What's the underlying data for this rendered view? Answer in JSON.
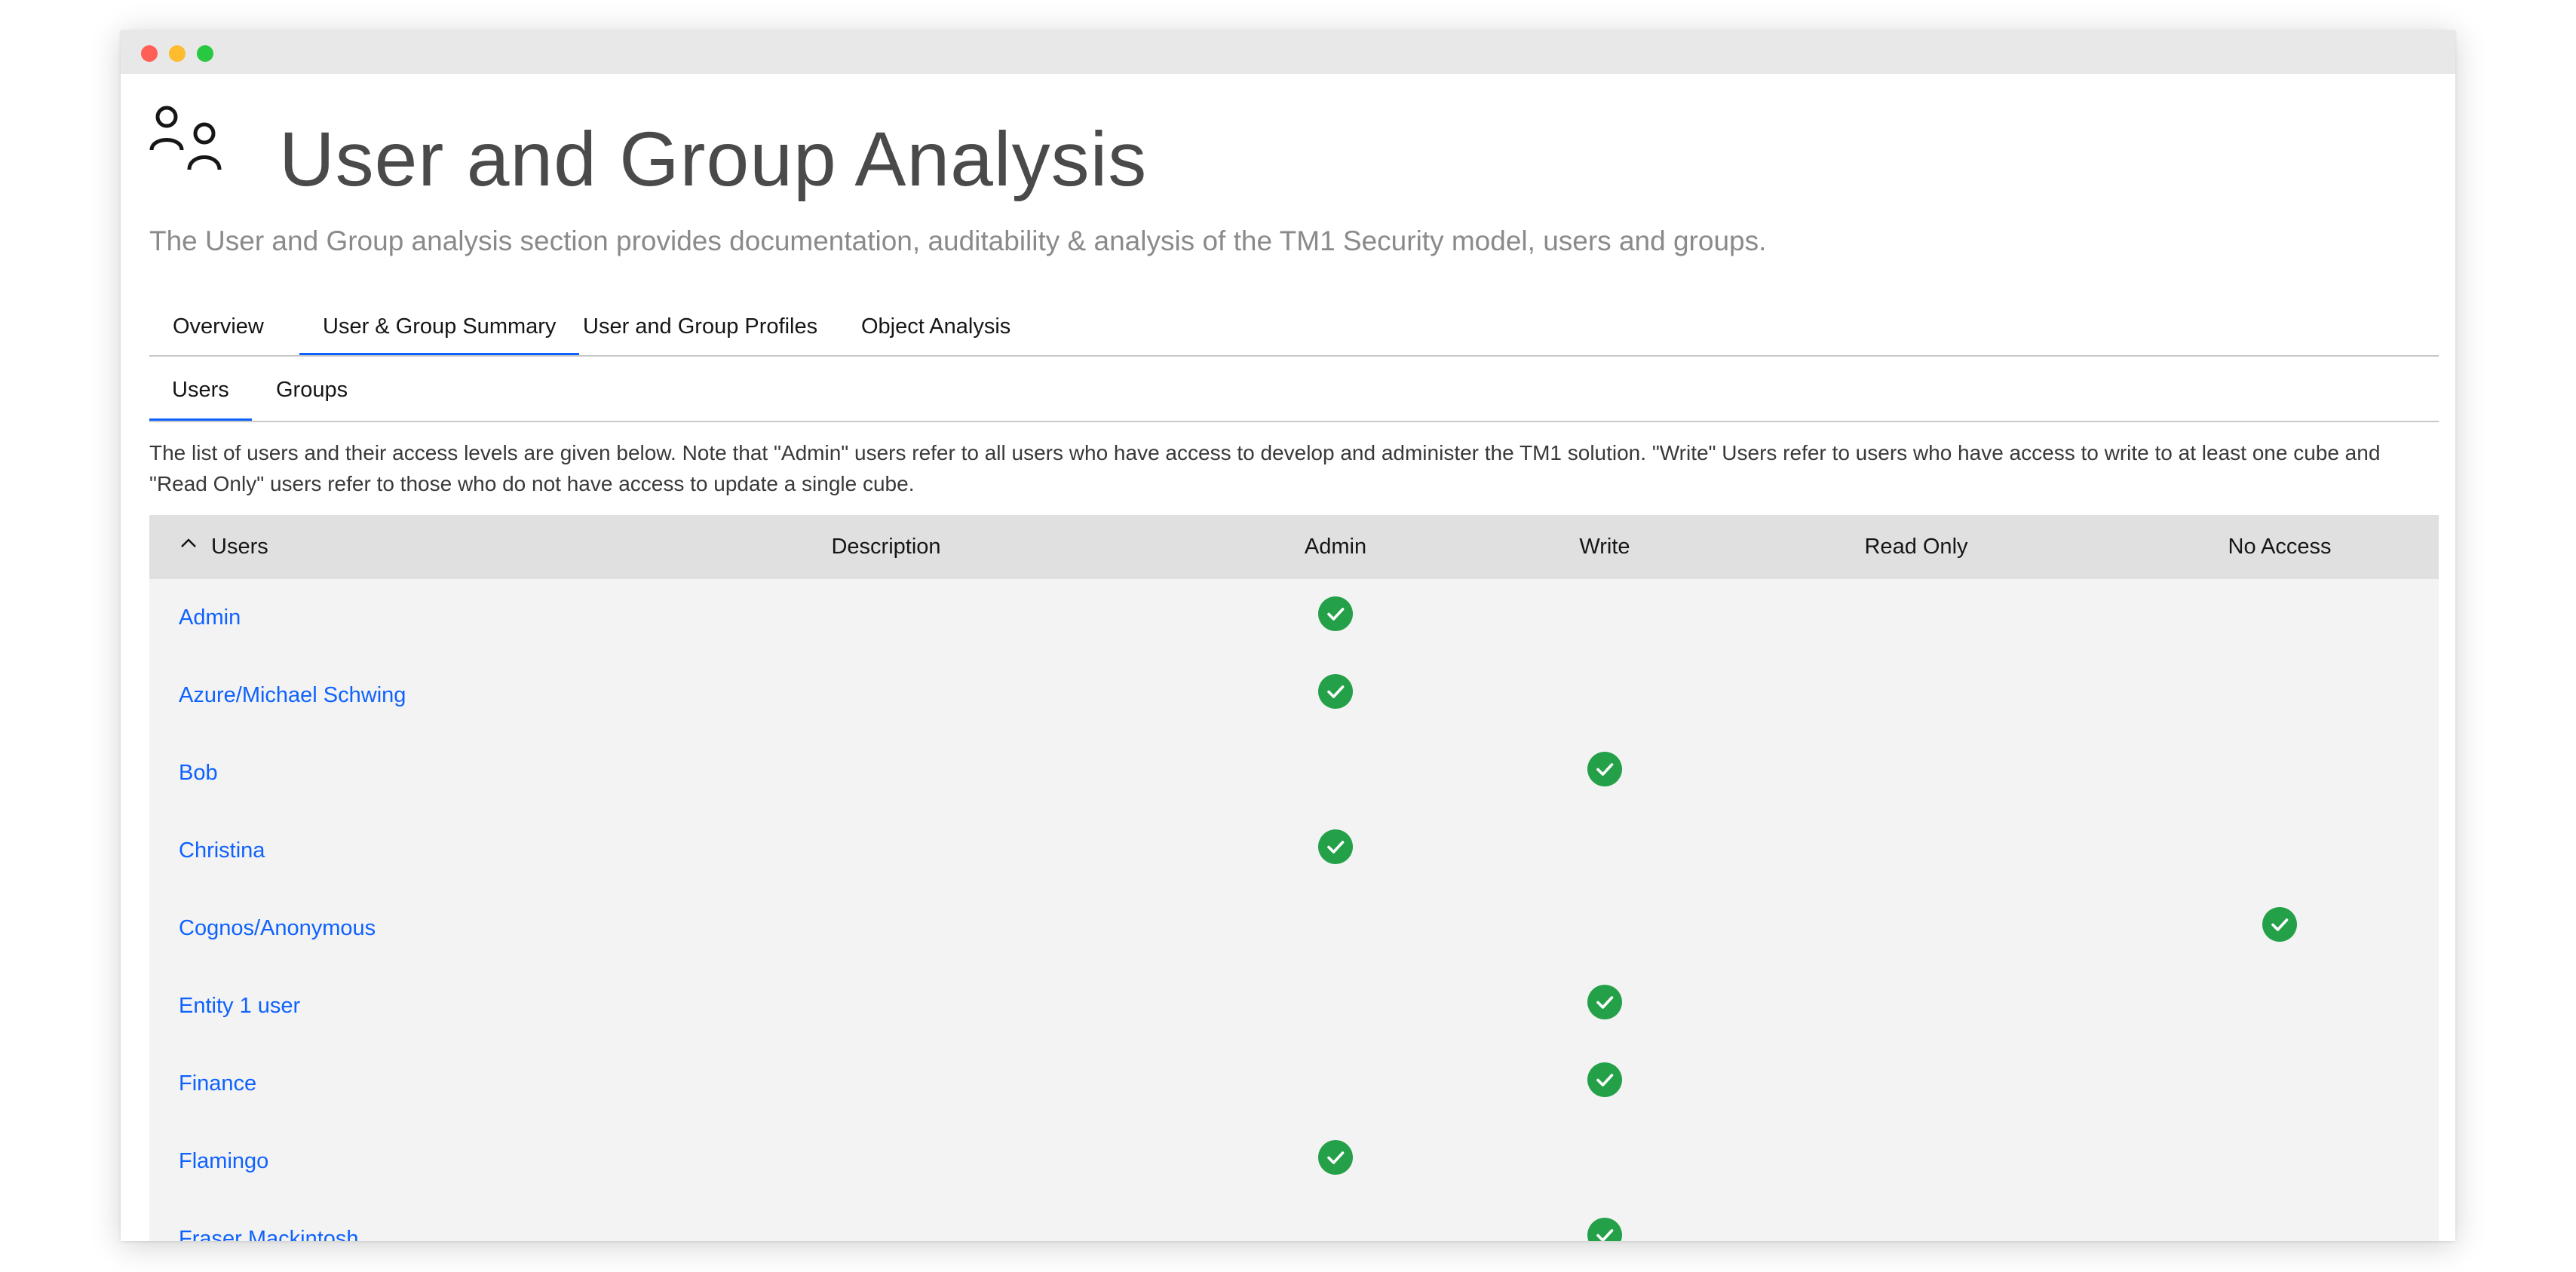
{
  "page": {
    "title": "User and Group Analysis",
    "subtitle": "The User and Group analysis section provides documentation, auditability & analysis of the TM1 Security model, users and groups.",
    "icon": "users-icon"
  },
  "tabs": [
    {
      "label": "Overview",
      "active": false
    },
    {
      "label": "User & Group Summary",
      "active": true
    },
    {
      "label": "User and Group Profiles",
      "active": false
    },
    {
      "label": "Object Analysis",
      "active": false
    }
  ],
  "subtabs": [
    {
      "label": "Users",
      "active": true
    },
    {
      "label": "Groups",
      "active": false
    }
  ],
  "note": "The list of users and their access levels are given below. Note that \"Admin\" users refer to all users who have access to develop and administer the TM1 solution. \"Write\" Users refer to users who have access to write to at least one cube and \"Read Only\" users refer to those who do not have access to update a single cube.",
  "table": {
    "sort_icon": "chevron-up-icon",
    "headers": {
      "users": "Users",
      "description": "Description",
      "admin": "Admin",
      "write": "Write",
      "read_only": "Read Only",
      "no_access": "No Access"
    },
    "rows": [
      {
        "name": "Admin",
        "description": "",
        "access": "admin"
      },
      {
        "name": "Azure/Michael Schwing",
        "description": "",
        "access": "admin"
      },
      {
        "name": "Bob",
        "description": "",
        "access": "write"
      },
      {
        "name": "Christina",
        "description": "",
        "access": "admin"
      },
      {
        "name": "Cognos/Anonymous",
        "description": "",
        "access": "no_access"
      },
      {
        "name": "Entity 1 user",
        "description": "",
        "access": "write"
      },
      {
        "name": "Finance",
        "description": "",
        "access": "write"
      },
      {
        "name": "Flamingo",
        "description": "",
        "access": "admin"
      },
      {
        "name": "Fraser Mackintosh",
        "description": "",
        "access": "write"
      }
    ]
  },
  "colors": {
    "accent": "#0f62fe",
    "check": "#24a148",
    "header_bg": "#e0e0e0",
    "table_bg": "#f3f3f3"
  }
}
